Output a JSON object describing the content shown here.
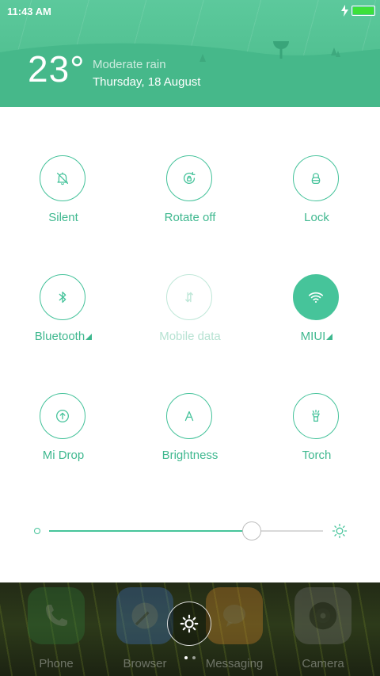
{
  "status_bar": {
    "time": "11:43 AM",
    "battery_color": "#3de03a",
    "charging": true
  },
  "weather": {
    "temperature": "23°",
    "condition": "Moderate rain",
    "date": "Thursday, 18 August"
  },
  "quick_settings": {
    "accent_color": "#46c49a",
    "tiles": [
      {
        "label": "Silent",
        "icon": "bell-off-icon",
        "state": "off"
      },
      {
        "label": "Rotate off",
        "icon": "rotate-lock-icon",
        "state": "off"
      },
      {
        "label": "Lock",
        "icon": "lock-icon",
        "state": "off"
      },
      {
        "label": "Bluetooth",
        "icon": "bluetooth-icon",
        "state": "off",
        "has_menu": true
      },
      {
        "label": "Mobile data",
        "icon": "mobile-data-icon",
        "state": "disabled"
      },
      {
        "label": "MIUI",
        "icon": "wifi-icon",
        "state": "on",
        "has_menu": true
      },
      {
        "label": "Mi Drop",
        "icon": "mi-drop-icon",
        "state": "off"
      },
      {
        "label": "Brightness",
        "icon": "brightness-auto-icon",
        "state": "off"
      },
      {
        "label": "Torch",
        "icon": "torch-icon",
        "state": "off"
      }
    ],
    "brightness_level": 0.74
  },
  "dock": {
    "apps": [
      {
        "label": "Phone",
        "icon": "phone-icon",
        "color": "#2f7a3a"
      },
      {
        "label": "Browser",
        "icon": "browser-icon",
        "color": "#3f73c6"
      },
      {
        "label": "Messaging",
        "icon": "messaging-icon",
        "color": "#d9872a"
      },
      {
        "label": "Camera",
        "icon": "camera-icon",
        "color": "#777777"
      }
    ],
    "settings_icon": "gear-icon",
    "page_count": 2
  }
}
